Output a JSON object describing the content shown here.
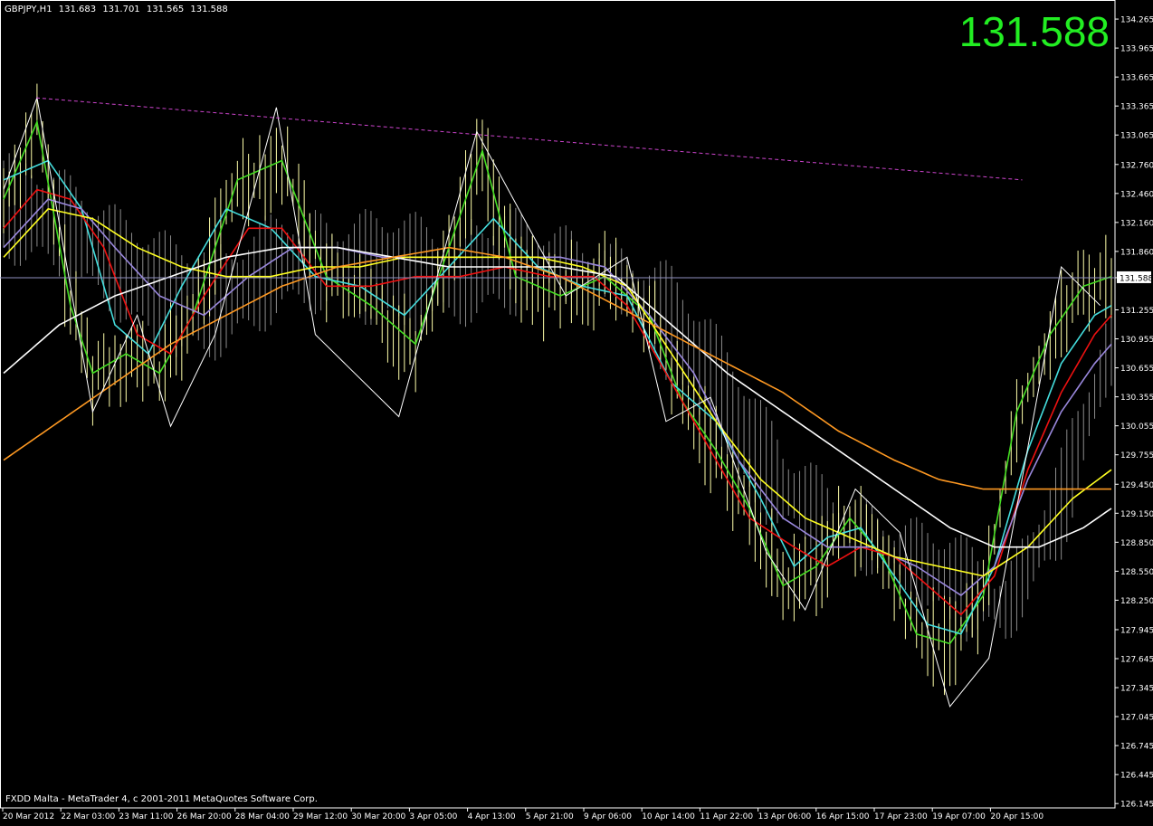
{
  "header": {
    "symbol": "GBPJPY,H1",
    "open": "131.683",
    "high": "131.701",
    "low": "131.565",
    "close": "131.588"
  },
  "big_price": "131.588",
  "footer": {
    "copyright": "FXDD Malta - MetaTrader 4, c 2001-2011 MetaQuotes Software Corp."
  },
  "colors": {
    "background": "#000000",
    "bars": "#ffffaa",
    "big_price": "#22ee22",
    "trendline": "#cc44cc",
    "cloud": "#8c8c8c",
    "price_line": "#8f8fbf",
    "zigzag": "#ffffff",
    "ma_green": "#44dd22",
    "ma_cyan": "#44dddd",
    "ma_red": "#ee1111",
    "ma_purple": "#9a88dd",
    "ma_yellow": "#ffff22",
    "ma_white": "#ffffff",
    "ma_orange": "#ff9922"
  },
  "chart_data": {
    "type": "line",
    "ylim": [
      126.1,
      134.35
    ],
    "y_ticks": [
      "134.265",
      "133.965",
      "133.665",
      "133.365",
      "133.065",
      "132.760",
      "132.460",
      "132.160",
      "131.860",
      "131.588",
      "131.255",
      "130.955",
      "130.655",
      "130.355",
      "130.055",
      "129.755",
      "129.450",
      "129.150",
      "128.850",
      "128.550",
      "128.250",
      "127.945",
      "127.645",
      "127.345",
      "127.045",
      "126.745",
      "126.445",
      "126.145"
    ],
    "x_labels": [
      "20 Mar 2012",
      "22 Mar 03:00",
      "23 Mar 11:00",
      "26 Mar 20:00",
      "28 Mar 04:00",
      "29 Mar 12:00",
      "30 Mar 20:00",
      "3 Apr 05:00",
      "4 Apr 13:00",
      "5 Apr 21:00",
      "9 Apr 06:00",
      "10 Apr 14:00",
      "11 Apr 22:00",
      "13 Apr 06:00",
      "16 Apr 15:00",
      "17 Apr 23:00",
      "19 Apr 07:00",
      "20 Apr 15:00"
    ],
    "current_price": 131.588,
    "trendline": {
      "points": [
        [
          0,
          133.45
        ],
        [
          183,
          132.6
        ]
      ]
    },
    "zigzag": [
      [
        0,
        132.5
      ],
      [
        6,
        133.45
      ],
      [
        16,
        130.2
      ],
      [
        24,
        131.2
      ],
      [
        30,
        130.05
      ],
      [
        38,
        131.0
      ],
      [
        49,
        133.35
      ],
      [
        56,
        131.0
      ],
      [
        71,
        130.15
      ],
      [
        85,
        133.1
      ],
      [
        101,
        131.4
      ],
      [
        112,
        131.8
      ],
      [
        119,
        130.1
      ],
      [
        127,
        130.35
      ],
      [
        137,
        128.75
      ],
      [
        144,
        128.15
      ],
      [
        153,
        129.4
      ],
      [
        161,
        128.95
      ],
      [
        170,
        127.15
      ],
      [
        177,
        127.65
      ],
      [
        190,
        131.7
      ],
      [
        197,
        131.3
      ]
    ],
    "series": [
      {
        "color_key": "ma_green",
        "values": [
          [
            0,
            132.4
          ],
          [
            6,
            133.2
          ],
          [
            12,
            131.3
          ],
          [
            16,
            130.6
          ],
          [
            22,
            130.8
          ],
          [
            28,
            130.6
          ],
          [
            34,
            131.2
          ],
          [
            42,
            132.6
          ],
          [
            50,
            132.8
          ],
          [
            58,
            131.6
          ],
          [
            66,
            131.3
          ],
          [
            74,
            130.9
          ],
          [
            80,
            131.9
          ],
          [
            86,
            132.9
          ],
          [
            92,
            131.6
          ],
          [
            100,
            131.4
          ],
          [
            108,
            131.6
          ],
          [
            116,
            131.2
          ],
          [
            122,
            130.3
          ],
          [
            128,
            129.8
          ],
          [
            134,
            129.2
          ],
          [
            140,
            128.4
          ],
          [
            146,
            128.6
          ],
          [
            152,
            129.1
          ],
          [
            158,
            128.7
          ],
          [
            164,
            127.9
          ],
          [
            170,
            127.8
          ],
          [
            176,
            128.3
          ],
          [
            182,
            130.2
          ],
          [
            188,
            131.0
          ],
          [
            194,
            131.5
          ],
          [
            199,
            131.6
          ]
        ]
      },
      {
        "color_key": "ma_cyan",
        "values": [
          [
            0,
            132.6
          ],
          [
            8,
            132.8
          ],
          [
            14,
            132.3
          ],
          [
            20,
            131.1
          ],
          [
            26,
            130.8
          ],
          [
            32,
            131.5
          ],
          [
            40,
            132.3
          ],
          [
            48,
            132.1
          ],
          [
            56,
            131.6
          ],
          [
            64,
            131.5
          ],
          [
            72,
            131.2
          ],
          [
            80,
            131.7
          ],
          [
            88,
            132.2
          ],
          [
            96,
            131.7
          ],
          [
            104,
            131.5
          ],
          [
            112,
            131.4
          ],
          [
            120,
            130.5
          ],
          [
            128,
            130.1
          ],
          [
            136,
            129.3
          ],
          [
            142,
            128.6
          ],
          [
            148,
            128.9
          ],
          [
            154,
            129.0
          ],
          [
            160,
            128.5
          ],
          [
            166,
            128.0
          ],
          [
            172,
            127.9
          ],
          [
            178,
            128.6
          ],
          [
            184,
            129.8
          ],
          [
            190,
            130.7
          ],
          [
            196,
            131.2
          ],
          [
            199,
            131.3
          ]
        ]
      },
      {
        "color_key": "ma_red",
        "values": [
          [
            0,
            132.1
          ],
          [
            6,
            132.5
          ],
          [
            12,
            132.4
          ],
          [
            18,
            131.9
          ],
          [
            24,
            131.0
          ],
          [
            30,
            130.8
          ],
          [
            36,
            131.4
          ],
          [
            44,
            132.1
          ],
          [
            50,
            132.1
          ],
          [
            58,
            131.5
          ],
          [
            66,
            131.5
          ],
          [
            74,
            131.6
          ],
          [
            82,
            131.6
          ],
          [
            90,
            131.7
          ],
          [
            98,
            131.6
          ],
          [
            106,
            131.6
          ],
          [
            112,
            131.3
          ],
          [
            120,
            130.5
          ],
          [
            128,
            129.7
          ],
          [
            134,
            129.1
          ],
          [
            142,
            128.8
          ],
          [
            148,
            128.6
          ],
          [
            154,
            128.8
          ],
          [
            160,
            128.7
          ],
          [
            166,
            128.4
          ],
          [
            172,
            128.1
          ],
          [
            178,
            128.5
          ],
          [
            184,
            129.6
          ],
          [
            190,
            130.4
          ],
          [
            196,
            131.0
          ],
          [
            199,
            131.2
          ]
        ]
      },
      {
        "color_key": "ma_purple",
        "values": [
          [
            0,
            131.9
          ],
          [
            8,
            132.4
          ],
          [
            14,
            132.3
          ],
          [
            20,
            131.9
          ],
          [
            28,
            131.4
          ],
          [
            36,
            131.2
          ],
          [
            44,
            131.6
          ],
          [
            52,
            131.9
          ],
          [
            60,
            131.9
          ],
          [
            68,
            131.8
          ],
          [
            76,
            131.8
          ],
          [
            84,
            131.8
          ],
          [
            92,
            131.8
          ],
          [
            100,
            131.8
          ],
          [
            108,
            131.7
          ],
          [
            116,
            131.2
          ],
          [
            124,
            130.6
          ],
          [
            132,
            129.7
          ],
          [
            140,
            129.1
          ],
          [
            148,
            128.8
          ],
          [
            156,
            128.8
          ],
          [
            164,
            128.6
          ],
          [
            172,
            128.3
          ],
          [
            178,
            128.6
          ],
          [
            184,
            129.5
          ],
          [
            190,
            130.2
          ],
          [
            196,
            130.7
          ],
          [
            199,
            130.9
          ]
        ]
      },
      {
        "color_key": "ma_yellow",
        "values": [
          [
            0,
            131.8
          ],
          [
            8,
            132.3
          ],
          [
            16,
            132.2
          ],
          [
            24,
            131.9
          ],
          [
            32,
            131.7
          ],
          [
            40,
            131.6
          ],
          [
            48,
            131.6
          ],
          [
            56,
            131.7
          ],
          [
            64,
            131.7
          ],
          [
            72,
            131.8
          ],
          [
            80,
            131.8
          ],
          [
            88,
            131.8
          ],
          [
            96,
            131.8
          ],
          [
            104,
            131.7
          ],
          [
            112,
            131.5
          ],
          [
            120,
            130.8
          ],
          [
            128,
            130.1
          ],
          [
            136,
            129.5
          ],
          [
            144,
            129.1
          ],
          [
            152,
            128.9
          ],
          [
            160,
            128.7
          ],
          [
            168,
            128.6
          ],
          [
            176,
            128.5
          ],
          [
            184,
            128.8
          ],
          [
            192,
            129.3
          ],
          [
            199,
            129.6
          ]
        ]
      },
      {
        "color_key": "ma_white",
        "values": [
          [
            0,
            130.6
          ],
          [
            10,
            131.1
          ],
          [
            20,
            131.4
          ],
          [
            30,
            131.6
          ],
          [
            40,
            131.8
          ],
          [
            50,
            131.9
          ],
          [
            60,
            131.9
          ],
          [
            70,
            131.8
          ],
          [
            80,
            131.7
          ],
          [
            90,
            131.7
          ],
          [
            100,
            131.7
          ],
          [
            110,
            131.6
          ],
          [
            120,
            131.1
          ],
          [
            130,
            130.6
          ],
          [
            140,
            130.2
          ],
          [
            150,
            129.8
          ],
          [
            160,
            129.4
          ],
          [
            170,
            129.0
          ],
          [
            178,
            128.8
          ],
          [
            186,
            128.8
          ],
          [
            194,
            129.0
          ],
          [
            199,
            129.2
          ]
        ]
      },
      {
        "color_key": "ma_orange",
        "values": [
          [
            0,
            129.7
          ],
          [
            10,
            130.1
          ],
          [
            20,
            130.5
          ],
          [
            30,
            130.9
          ],
          [
            40,
            131.2
          ],
          [
            50,
            131.5
          ],
          [
            60,
            131.7
          ],
          [
            70,
            131.8
          ],
          [
            80,
            131.9
          ],
          [
            90,
            131.8
          ],
          [
            100,
            131.6
          ],
          [
            110,
            131.3
          ],
          [
            120,
            131.0
          ],
          [
            130,
            130.7
          ],
          [
            140,
            130.4
          ],
          [
            150,
            130.0
          ],
          [
            160,
            129.7
          ],
          [
            168,
            129.5
          ],
          [
            176,
            129.4
          ],
          [
            184,
            129.4
          ],
          [
            192,
            129.4
          ],
          [
            199,
            129.4
          ]
        ]
      }
    ],
    "cloud": [
      [
        0,
        132.8,
        131.9
      ],
      [
        10,
        132.6,
        131.7
      ],
      [
        20,
        132.2,
        131.3
      ],
      [
        30,
        131.9,
        130.8
      ],
      [
        40,
        131.8,
        130.9
      ],
      [
        50,
        132.2,
        131.3
      ],
      [
        60,
        132.1,
        131.4
      ],
      [
        70,
        132.2,
        131.1
      ],
      [
        80,
        132.0,
        131.2
      ],
      [
        90,
        132.2,
        131.3
      ],
      [
        100,
        132.0,
        131.5
      ],
      [
        110,
        131.8,
        131.4
      ],
      [
        120,
        131.6,
        130.6
      ],
      [
        130,
        130.8,
        129.6
      ],
      [
        140,
        129.8,
        129.0
      ],
      [
        150,
        129.3,
        128.8
      ],
      [
        160,
        129.0,
        128.5
      ],
      [
        170,
        128.9,
        128.0
      ],
      [
        180,
        128.4,
        127.9
      ],
      [
        190,
        129.7,
        128.8
      ],
      [
        200,
        131.4,
        130.8
      ]
    ],
    "bars_count": 200
  }
}
